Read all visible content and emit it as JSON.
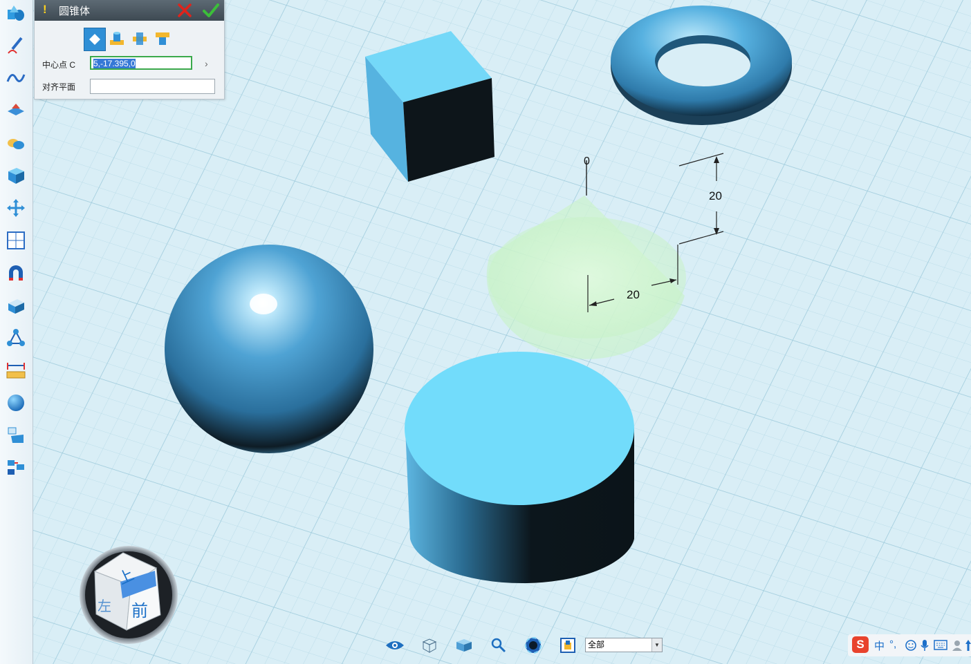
{
  "toolbar": {
    "items": [
      {
        "name": "basic-solids-tool"
      },
      {
        "name": "sketch-draw-tool"
      },
      {
        "name": "curve-tool"
      },
      {
        "name": "feature-tool"
      },
      {
        "name": "special-feature-tool"
      },
      {
        "name": "edit-solid-tool"
      },
      {
        "name": "move-tool"
      },
      {
        "name": "array-tool"
      },
      {
        "name": "adsorb-tool"
      },
      {
        "name": "combine-tool"
      },
      {
        "name": "group-tool"
      },
      {
        "name": "measure-tool"
      },
      {
        "name": "material-sphere-tool"
      },
      {
        "name": "insert-tool"
      },
      {
        "name": "manage-tool"
      }
    ]
  },
  "dialog": {
    "title": "圆锥体",
    "warning_glyph": "!",
    "center_label": "中心点 C",
    "center_value": "5,-17.395,0",
    "align_label": "对齐平面",
    "align_value": "",
    "expand_glyph": "›"
  },
  "scene": {
    "dimensions": [
      "20",
      "20"
    ],
    "cone_apex_label": "0"
  },
  "view_cube": {
    "top_face": "上",
    "front_face": "前",
    "left_face": "左"
  },
  "bottom_bar": {
    "layer_value": "全部"
  },
  "ime": {
    "logo": "S",
    "lang": "中",
    "punct": "°,"
  },
  "colors": {
    "solid": "#6fd6f7",
    "solid_dark": "#0d1418",
    "grid_bg": "#d9eef6",
    "cone_preview": "#c9f5c7",
    "accent": "#2f8fd6"
  }
}
